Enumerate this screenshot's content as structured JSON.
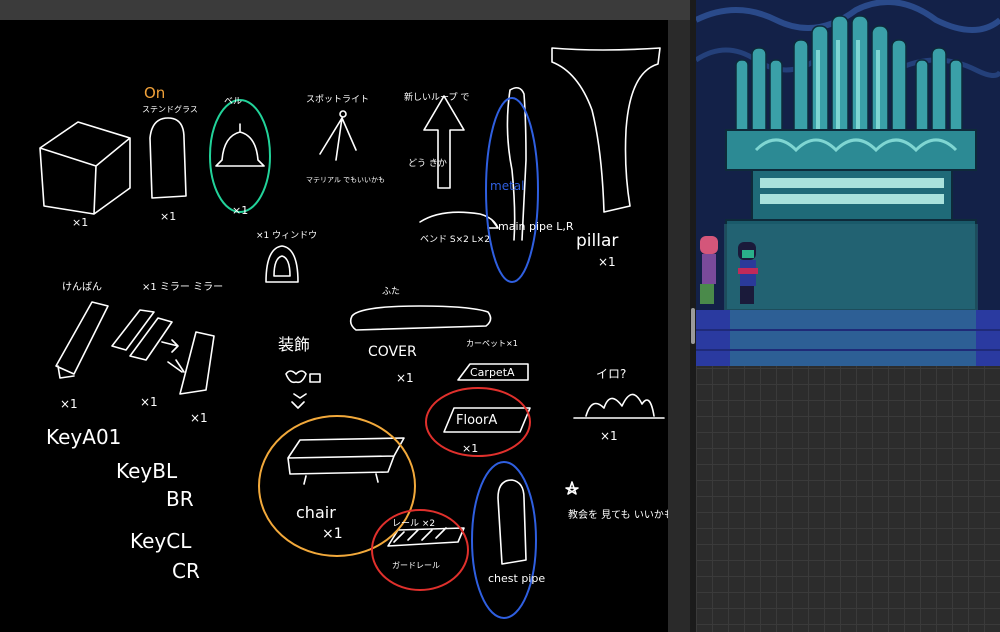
{
  "sketch": {
    "labels": {
      "on_label": "On",
      "stained_glass_label": "ステンドグラス",
      "bell_label": "ベル",
      "spotlight_label": "スポットライト",
      "spotlight_note": "マテリアル でもいいかも",
      "loop_note": "新しいループ で",
      "direction_note": "どう きか",
      "metal_label": "metal",
      "bend_note": "ベンド S×2 L×2",
      "main_pipe_label": "main pipe L,R",
      "pillar_label": "pillar",
      "pillar_count": "×1",
      "cube_count": "×1",
      "stained_count": "×1",
      "bell_count": "×1",
      "small_window_label": "×1 ウィンドウ",
      "keyboard_label": "けんばん",
      "mirror_label": "×1 ミラー ミラー",
      "key_count_a": "×1",
      "key_count_b": "×1",
      "key_count_c": "×1",
      "key_a01": "KeyA01",
      "key_bl": "KeyBL",
      "key_br": "BR",
      "key_cl": "KeyCL",
      "key_cr": "CR",
      "decoration_label": "装飾",
      "cover_top_label": "ふた",
      "cover_label": "COVER",
      "cover_count": "×1",
      "carpet_note": "カーペット×1",
      "carpet_label": "CarpetA",
      "floor_label": "FloorA",
      "floor_count": "×1",
      "chair_label": "chair",
      "chair_count": "×1",
      "rail_note": "レール ×2",
      "rail_sub": "ガードレール",
      "chest_pipe_label": "chest pipe",
      "ira_label": "イロ?",
      "ira_count": "×1",
      "star_note": "教会を 見ても いいかも"
    },
    "colors": {
      "stroke": "#ffffff",
      "bell_circle": "#22d39a",
      "metal_circle": "#2f5fe0",
      "chair_circle": "#f2a93b",
      "red_circle": "#e0302c",
      "chest_circle": "#2f5fe0",
      "on_text": "#f2a23a"
    }
  },
  "game": {
    "scene": "pipe-organ-room"
  }
}
